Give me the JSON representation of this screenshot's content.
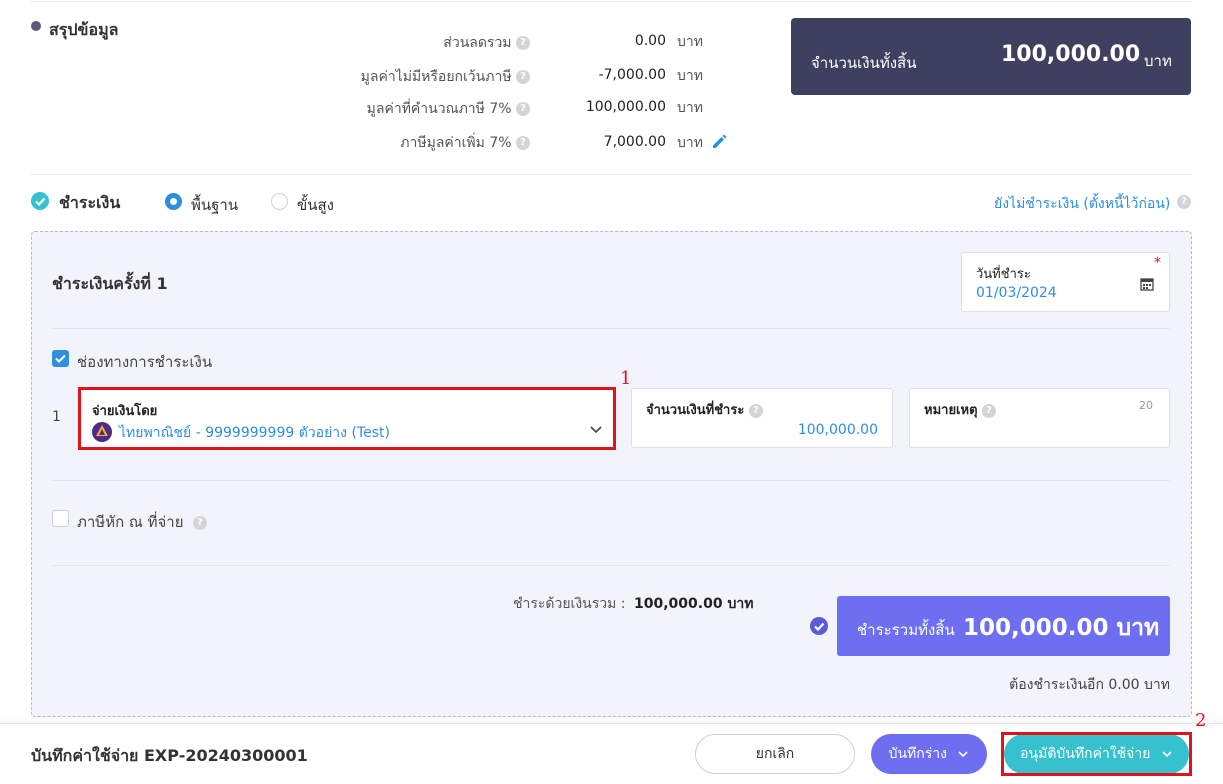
{
  "summary": {
    "title": "สรุปข้อมูล",
    "rows": [
      {
        "label": "ส่วนลดรวม",
        "value": "0.00",
        "unit": "บาท"
      },
      {
        "label": "มูลค่าไม่มีหรือยกเว้นภาษี",
        "value": "-7,000.00",
        "unit": "บาท"
      },
      {
        "label": "มูลค่าที่คำนวณภาษี 7%",
        "value": "100,000.00",
        "unit": "บาท"
      },
      {
        "label": "ภาษีมูลค่าเพิ่ม 7%",
        "value": "7,000.00",
        "unit": "บาท"
      }
    ],
    "total_label": "จำนวนเงินทั้งสิ้น",
    "total_value": "100,000.00",
    "total_unit": "บาท",
    "accent": "#3f3f5f"
  },
  "payment": {
    "title": "ชำระเงิน",
    "mode_basic": "พื้นฐาน",
    "mode_advanced": "ขั้นสูง",
    "unpaid_link": "ยังไม่ชำระเงิน (ตั้งหนี้ไว้ก่อน)",
    "round_title": "ชำระเงินครั้งที่ 1",
    "date_label": "วันที่ชำระ",
    "date_value": "01/03/2024",
    "channel_label": "ช่องทางการชำระเงิน",
    "row_index": "1",
    "pay_by_label": "จ่ายเงินโดย",
    "pay_by_value": "ไทยพาณิชย์ - 9999999999 ตัวอย่าง (Test)",
    "amount_label": "จำนวนเงินที่ชำระ",
    "amount_value": "100,000.00",
    "note_label": "หมายเหตุ",
    "note_counter": "20",
    "withholding_label": "ภาษีหัก ณ ที่จ่าย",
    "paid_total_label": "ชำระด้วยเงินรวม :",
    "paid_total_value": "100,000.00 บาท",
    "grand_label": "ชำระรวมทั้งสิ้น",
    "grand_value": "100,000.00 บาท",
    "remaining": "ต้องชำระเงินอีก 0.00 บาท",
    "grand_color": "#6e6ef0"
  },
  "annotations": {
    "tag1": "1",
    "tag2": "2"
  },
  "footer": {
    "doc_title": "บันทึกค่าใช้จ่าย EXP-20240300001",
    "cancel": "ยกเลิก",
    "draft": "บันทึกร่าง",
    "approve": "อนุมัติบันทึกค่าใช้จ่าย",
    "draft_color": "#6e6ef0",
    "approve_color": "#36c1cf"
  }
}
